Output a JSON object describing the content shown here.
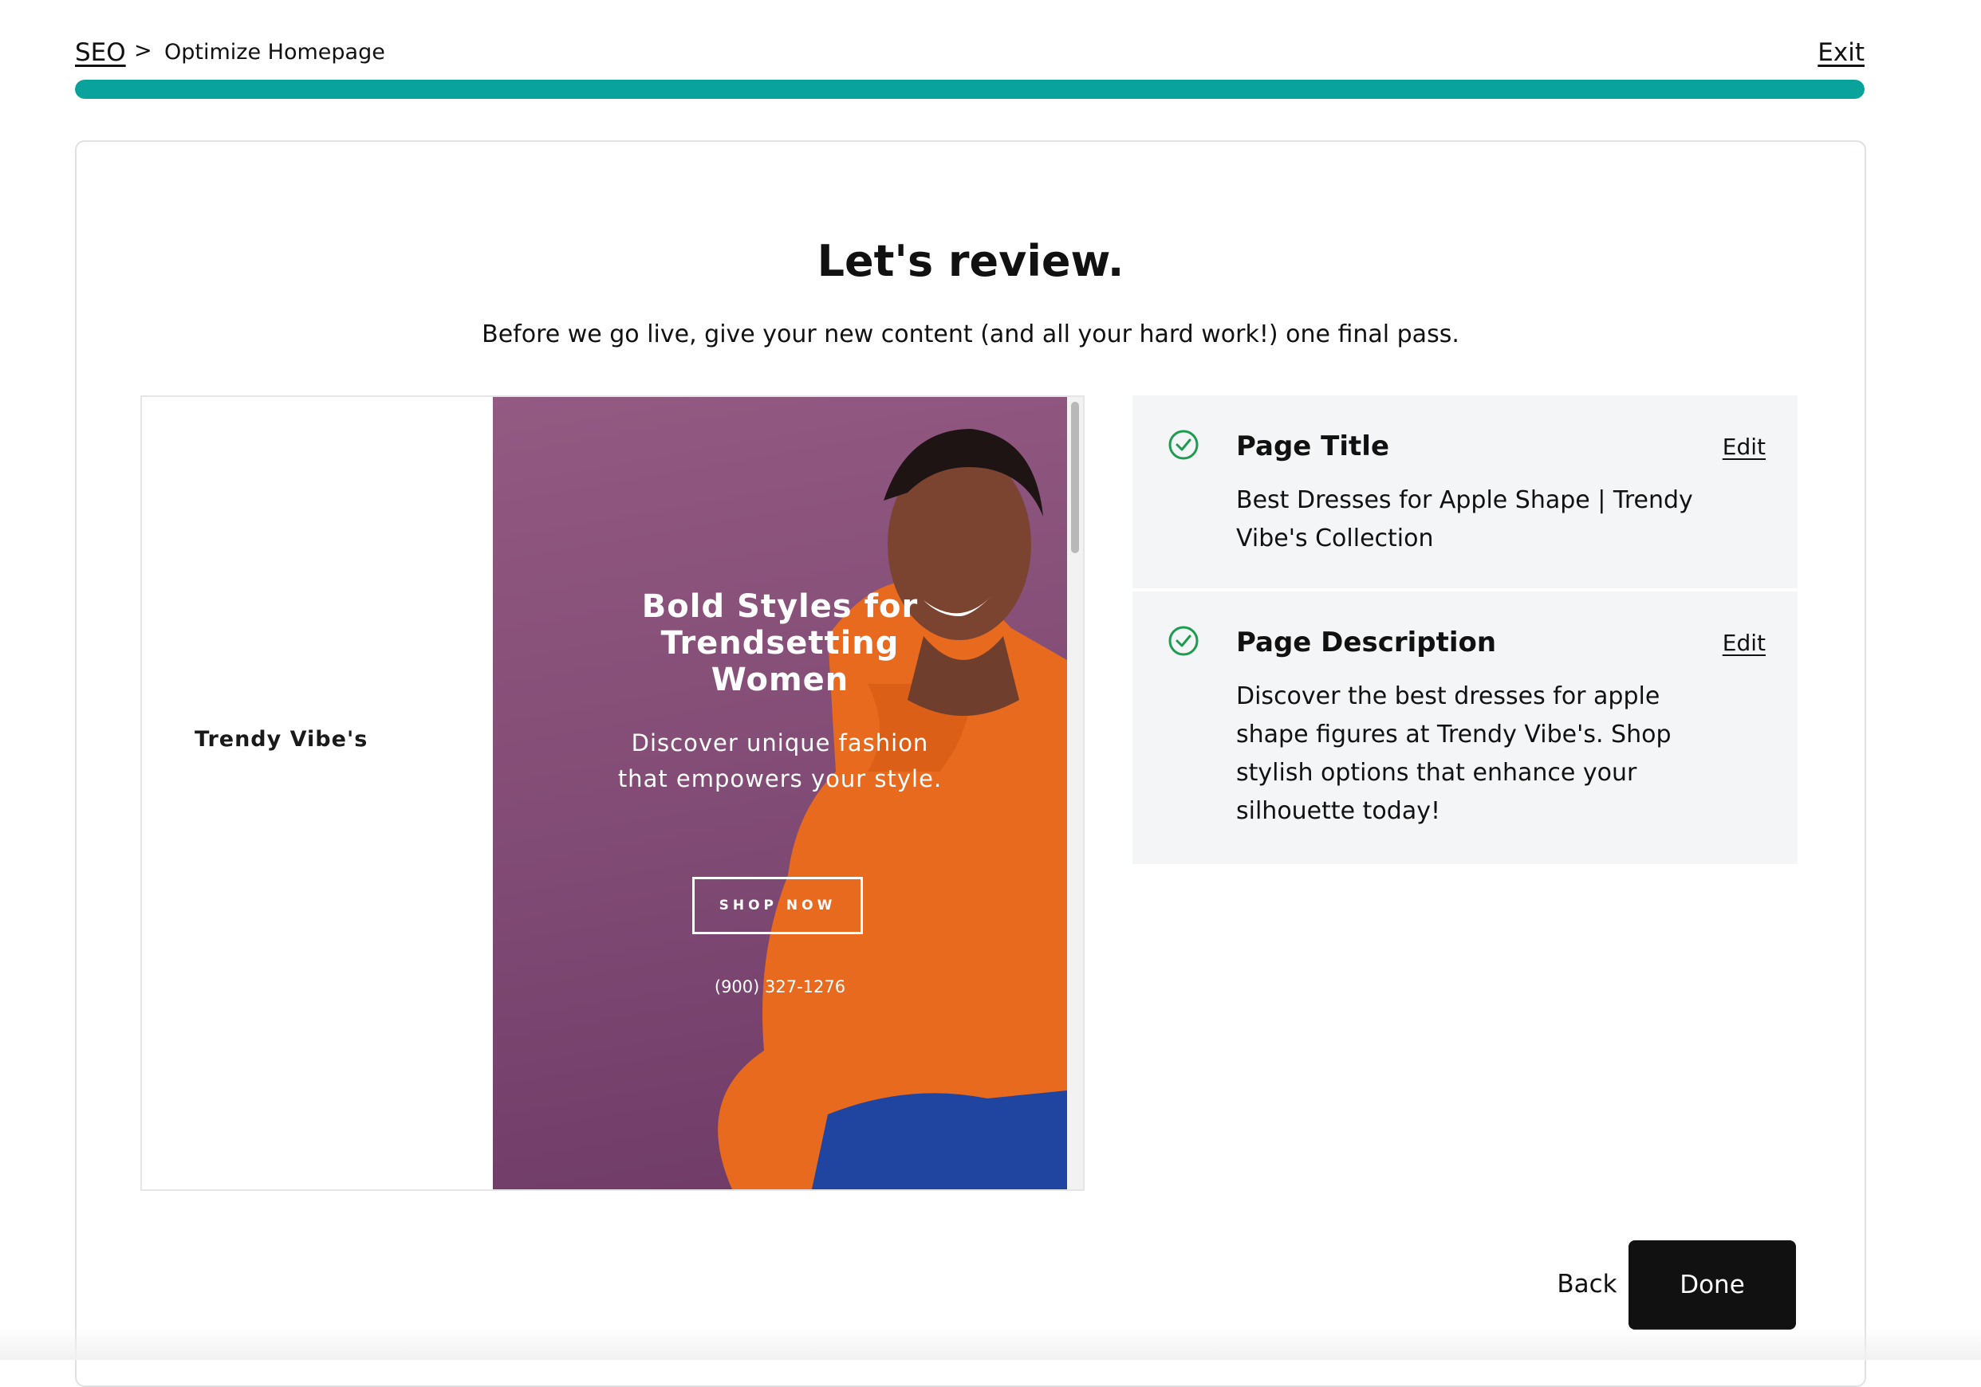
{
  "breadcrumb": {
    "root": "SEO",
    "separator": ">",
    "current": "Optimize Homepage"
  },
  "header": {
    "exit_label": "Exit"
  },
  "progress": {
    "percent": 100,
    "color": "#0aa39c"
  },
  "main": {
    "title": "Let's review.",
    "subtitle": "Before we go live, give your new content (and all your hard work!) one final pass."
  },
  "preview": {
    "brand": "Trendy Vibe's",
    "hero_heading": "Bold Styles for Trendsetting Women",
    "hero_text": "Discover unique fashion that empowers your style.",
    "cta_label": "SHOP NOW",
    "phone": "(900) 327-1276",
    "hero_color": "#8a5279"
  },
  "review": {
    "title_item": {
      "label": "Page Title",
      "edit_label": "Edit",
      "value": "Best Dresses for Apple Shape | Trendy Vibe's Collection",
      "status_icon": "check-circle-icon"
    },
    "description_item": {
      "label": "Page Description",
      "edit_label": "Edit",
      "value": "Discover the best dresses for apple shape figures at Trendy Vibe's. Shop stylish options that enhance your silhouette today!",
      "status_icon": "check-circle-icon"
    }
  },
  "footer": {
    "back_label": "Back",
    "done_label": "Done"
  },
  "colors": {
    "accent": "#0aa39c",
    "success": "#1d9c4f",
    "primary_button": "#111111"
  }
}
